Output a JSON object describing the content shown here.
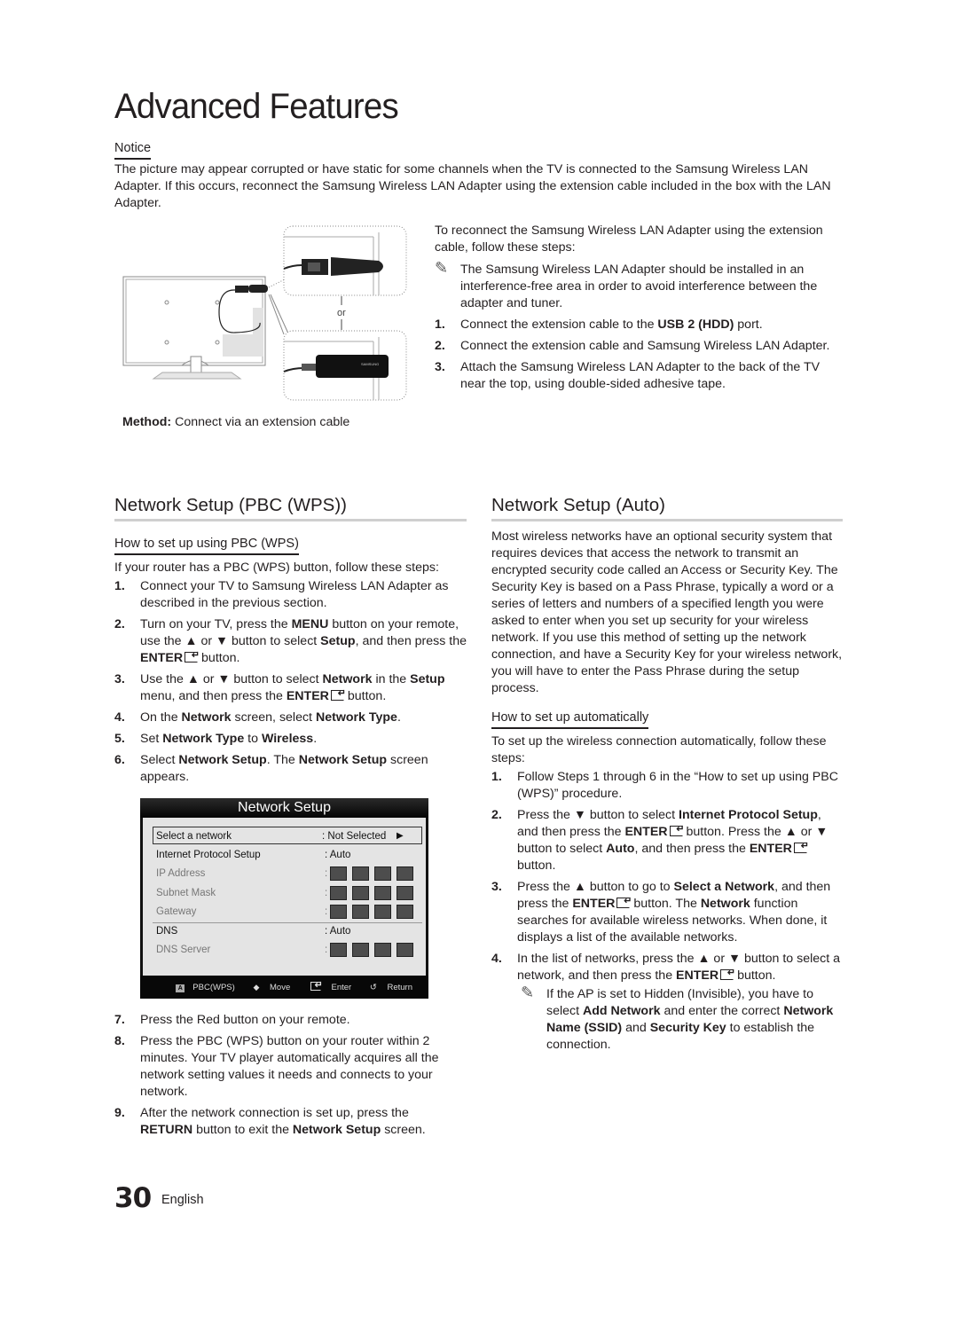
{
  "page": {
    "title": "Advanced Features",
    "page_number": "30",
    "language": "English"
  },
  "notice": {
    "heading": "Notice",
    "text": "The picture may appear corrupted or have static for some channels when the TV is connected to the Samsung Wireless LAN Adapter. If this occurs, reconnect the Samsung Wireless LAN Adapter using the extension cable included in the box with the LAN Adapter."
  },
  "diagram": {
    "or_label": "or",
    "brand_label": "SAMSUNG",
    "caption_bold": "Method:",
    "caption_text": " Connect via an extension cable"
  },
  "reconnect": {
    "intro": "To reconnect the Samsung Wireless LAN Adapter using the extension cable, follow these steps:",
    "note": "The Samsung Wireless LAN Adapter should be installed in an interference-free area in order to avoid interference between the adapter and tuner.",
    "steps": [
      {
        "num": "1.",
        "a": "Connect the extension cable to the ",
        "b": "USB 2 (HDD)",
        "c": " port."
      },
      {
        "num": "2.",
        "text": "Connect the extension cable and Samsung Wireless LAN Adapter."
      },
      {
        "num": "3.",
        "text": "Attach the Samsung Wireless LAN Adapter to the back of the TV near the top, using double-sided adhesive tape."
      }
    ]
  },
  "pbc": {
    "title": "Network Setup (PBC (WPS))",
    "subheading": "How to set up using PBC (WPS)",
    "intro": "If your router has a PBC (WPS) button, follow these steps:",
    "steps": {
      "s1": {
        "num": "1.",
        "text": "Connect your TV to Samsung Wireless LAN Adapter as described in the previous section."
      },
      "s2": {
        "num": "2.",
        "t1": "Turn on your TV, press the ",
        "b1": "MENU",
        "t2": " button on your remote, use the ▲ or ▼ button to select ",
        "b2": "Setup",
        "t3": ", and then press the ",
        "b3": "ENTER",
        "t4": " button."
      },
      "s3": {
        "num": "3.",
        "t1": "Use the ▲ or ▼ button to select ",
        "b1": "Network",
        "t2": " in the ",
        "b2": "Setup",
        "t3": " menu, and then press the ",
        "b3": "ENTER",
        "t4": " button."
      },
      "s4": {
        "num": "4.",
        "t1": "On the ",
        "b1": "Network",
        "t2": " screen, select ",
        "b2": "Network Type",
        "t3": "."
      },
      "s5": {
        "num": "5.",
        "t1": "Set ",
        "b1": "Network Type",
        "t2": " to ",
        "b2": "Wireless",
        "t3": "."
      },
      "s6": {
        "num": "6.",
        "t1": "Select ",
        "b1": "Network Setup",
        "t2": ". The ",
        "b2": "Network Setup",
        "t3": " screen appears."
      },
      "s7": {
        "num": "7.",
        "text": "Press the Red button on your remote."
      },
      "s8": {
        "num": "8.",
        "text": "Press the PBC (WPS) button on your router within 2 minutes. Your TV player automatically acquires all the network setting values it needs and connects to your network."
      },
      "s9": {
        "num": "9.",
        "t1": "After the network connection is set up, press the ",
        "b1": "RETURN",
        "t2": " button to exit the ",
        "b2": "Network Setup",
        "t3": " screen."
      }
    }
  },
  "osd": {
    "title": "Network Setup",
    "rows": [
      {
        "label": "Select a network",
        "value": ": Not Selected",
        "arrow": "▶"
      },
      {
        "label": "Internet Protocol Setup",
        "value": ": Auto"
      },
      {
        "label": "IP Address",
        "value": ":"
      },
      {
        "label": "Subnet Mask",
        "value": ":"
      },
      {
        "label": "Gateway",
        "value": ":"
      },
      {
        "label": "DNS",
        "value": ": Auto"
      },
      {
        "label": "DNS Server",
        "value": ":"
      }
    ],
    "footer": {
      "pbc_key": "A",
      "pbc": "PBC(WPS)",
      "move_icon": "◆",
      "move": "Move",
      "enter": "Enter",
      "return_icon": "↺",
      "return": "Return"
    }
  },
  "auto": {
    "title": "Network Setup (Auto)",
    "intro": "Most wireless networks have an optional security system that requires devices that access the network to transmit an encrypted security code called an Access or Security Key. The Security Key is based on a Pass Phrase, typically a word or a series of letters and numbers of a specified length you were asked to enter when you set up security for your wireless network.  If you use this method of setting up the network connection, and have a Security Key for your wireless network, you will have to enter the Pass Phrase during the setup process.",
    "subheading": "How to set up automatically",
    "sub_intro": "To set up the wireless connection automatically, follow these steps:",
    "steps": {
      "s1": {
        "num": "1.",
        "text": "Follow Steps 1 through 6 in the “How to set up using PBC (WPS)” procedure."
      },
      "s2": {
        "num": "2.",
        "t1": "Press the ▼ button to select ",
        "b1": "Internet Protocol Setup",
        "t2": ", and then press the ",
        "b2": "ENTER",
        "t3": " button. Press the ▲ or ▼ button to select ",
        "b3": "Auto",
        "t4": ", and then press the ",
        "b4": "ENTER",
        "t5": " button."
      },
      "s3": {
        "num": "3.",
        "t1": "Press the ▲ button to go to ",
        "b1": "Select a Network",
        "t2": ", and then press the ",
        "b2": "ENTER",
        "t3": " button. The ",
        "b3": "Network",
        "t4": " function searches for available wireless networks. When done, it displays a list of the available networks."
      },
      "s4": {
        "num": "4.",
        "t1": "In the list of networks, press the ▲ or ▼ button to select a network, and then press the ",
        "b1": "ENTER",
        "t2": " button."
      }
    },
    "note": {
      "t1": "If the AP is set to Hidden (Invisible), you have to select ",
      "b1": "Add Network",
      "t2": " and enter the correct ",
      "b2": "Network Name (SSID)",
      "t3": " and ",
      "b3": "Security Key",
      "t4": " to establish the connection."
    }
  }
}
